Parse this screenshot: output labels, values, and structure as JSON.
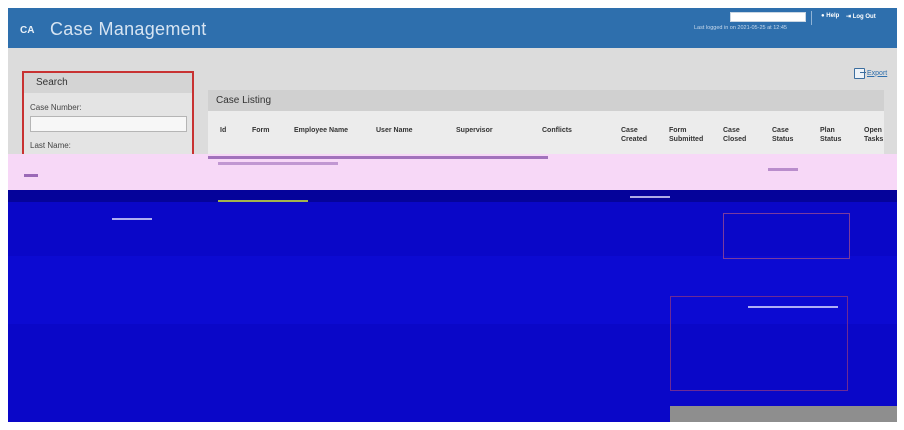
{
  "header": {
    "title": "Case Management",
    "logo_text": "CA",
    "help": "Help",
    "logout": "Log Out",
    "last_login": "Last logged in on 2021-05-25 at 12:45"
  },
  "toolbar": {
    "export": "Export"
  },
  "search": {
    "title": "Search",
    "case_number_label": "Case Number:",
    "last_name_label": "Last Name:"
  },
  "listing": {
    "title": "Case Listing",
    "columns": [
      "Id",
      "Form",
      "Employee Name",
      "User Name",
      "Supervisor",
      "Conflicts",
      "Case Created",
      "Form Submitted",
      "Case Closed",
      "Case Status",
      "Plan Status",
      "Open Tasks"
    ]
  },
  "colors": {
    "header_bg": "#2e6fad",
    "search_border": "#c83232",
    "glitch_blue": "#0a07c8",
    "glitch_pink": "#f7d8f7"
  }
}
